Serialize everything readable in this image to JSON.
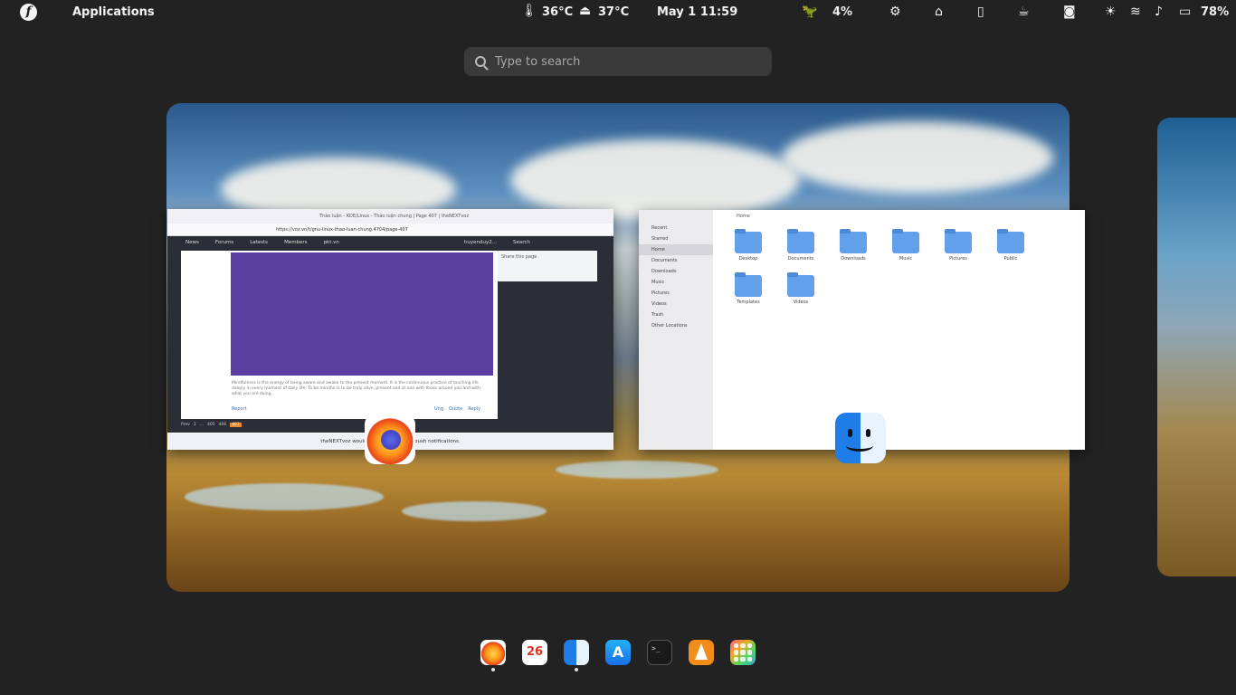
{
  "topbar": {
    "logo": "f",
    "applications_label": "Applications",
    "cpu_temp": "36°C",
    "disk_temp": "37°C",
    "datetime": "May 1  11:59",
    "cpu_load": "4%",
    "battery": "78%",
    "icons": [
      "thermometer-icon",
      "disk-icon",
      "dino-icon",
      "puzzle-icon",
      "home-icon",
      "clipboard-icon",
      "coffee-icon",
      "screenshot-icon",
      "brightness-icon",
      "wifi-icon",
      "volume-icon",
      "battery-icon"
    ]
  },
  "search": {
    "placeholder": "Type to search"
  },
  "windows": {
    "browser": {
      "tab_title": "Thảo luận - KDE/Linux - Thảo luận chung | Page 407 | theNEXTvoz",
      "url": "https://voz.vn/t/gnu-linux-thao-luan-chung.4704/page-407",
      "nav": [
        "News",
        "Forums",
        "Latests",
        "Members",
        "pkt.vn"
      ],
      "user": "huyenduy2...",
      "search_label": "Search",
      "share_label": "Share this page",
      "post_text": "Mindfulness is the energy of being aware and awake to the present moment. It is the continuous practice of touching life deeply in every moment of daily life. To be mindful is to be truly alive, present and at one with those around you and with what you are doing.",
      "report_label": "Report",
      "actions": [
        "Ung",
        "Quote",
        "Reply"
      ],
      "pagination": [
        "Prev",
        "1",
        "...",
        "405",
        "406",
        "407"
      ],
      "notification": "theNEXTvoz would like you to enable push notifications."
    },
    "files": {
      "sidebar": [
        "Recent",
        "Starred",
        "Home",
        "Documents",
        "Downloads",
        "Music",
        "Pictures",
        "Videos",
        "Trash",
        "Other Locations"
      ],
      "path": "Home",
      "folders": [
        "Desktop",
        "Documents",
        "Downloads",
        "Music",
        "Pictures",
        "Public",
        "Templates",
        "Videos"
      ]
    }
  },
  "dock": {
    "calendar_day": "26",
    "terminal_prompt": ">_",
    "items": [
      "firefox-icon",
      "calendar-icon",
      "finder-icon",
      "app-store-icon",
      "terminal-icon",
      "vlc-icon",
      "app-grid-icon"
    ]
  }
}
